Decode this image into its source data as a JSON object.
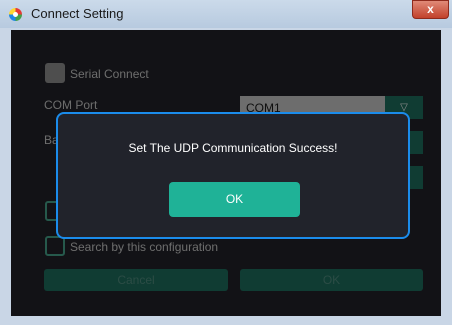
{
  "window": {
    "title": "Connect Setting",
    "close_label": "x"
  },
  "form": {
    "serial_connect_label": "Serial Connect",
    "com_port_label": "COM Port",
    "com_port_value": "COM1",
    "baud_label_partial": "Ba",
    "search_config_label": "Search by this configuration",
    "cancel_label": "Cancel",
    "ok_label": "OK",
    "dropdown_arrow": "▽"
  },
  "dialog": {
    "message": "Set The UDP Communication Success!",
    "ok_label": "OK"
  },
  "colors": {
    "accent_teal": "#1fb297",
    "dialog_border": "#1b8ceb",
    "panel_bg": "#212228"
  }
}
